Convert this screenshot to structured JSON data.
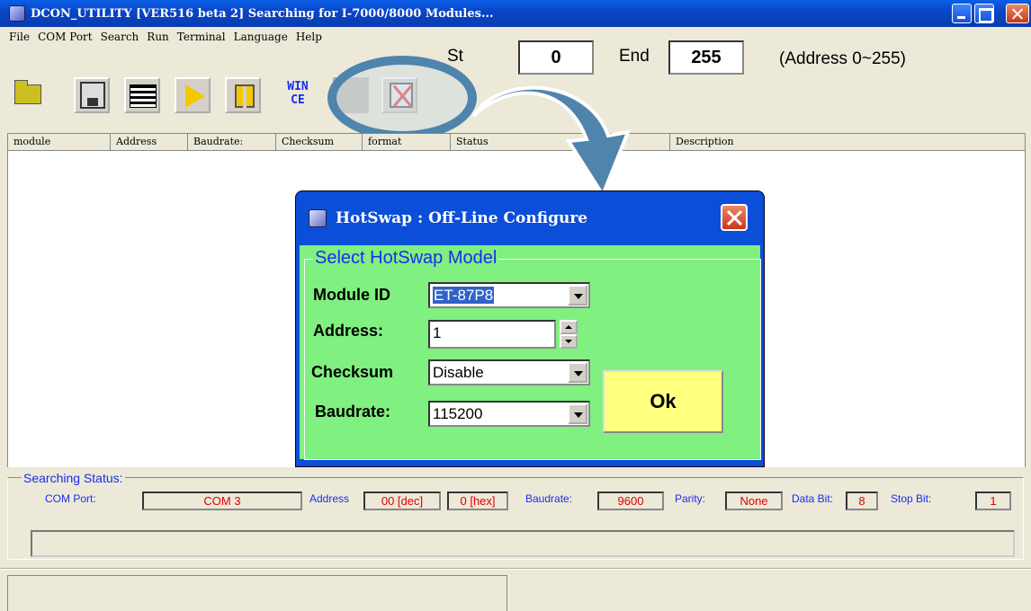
{
  "window": {
    "title": "DCON_UTILITY [VER516 beta 2] Searching for I-7000/8000 Modules..."
  },
  "menu": [
    "File",
    "COM Port",
    "Search",
    "Run",
    "Terminal",
    "Language",
    "Help"
  ],
  "toolbar": {
    "wince_label": "WIN CE",
    "start_label": "St",
    "start_value": "0",
    "end_label": "End",
    "end_value": "255",
    "range_text": "(Address 0~255)"
  },
  "list": {
    "columns": [
      "module",
      "Address",
      "Baudrate:",
      "Checksum",
      "format",
      "Status",
      "Description"
    ]
  },
  "dialog": {
    "title": "HotSwap : Off-Line Configure",
    "group_title": "Select HotSwap Model",
    "module_id_label": "Module ID",
    "module_id_value": "ET-87P8",
    "address_label": "Address:",
    "address_value": "1",
    "checksum_label": "Checksum",
    "checksum_value": "Disable",
    "baudrate_label": "Baudrate:",
    "baudrate_value": "115200",
    "ok_label": "Ok"
  },
  "status": {
    "group_title": "Searching Status:",
    "com_port_label": "COM Port:",
    "com_port_value": "COM 3",
    "address_label": "Address",
    "address_dec": "00 [dec]",
    "address_hex": "0 [hex]",
    "baudrate_label": "Baudrate:",
    "baudrate_value": "9600",
    "parity_label": "Parity:",
    "parity_value": "None",
    "databit_label": "Data Bit:",
    "databit_value": "8",
    "stopbit_label": "Stop Bit:",
    "stopbit_value": "1"
  }
}
